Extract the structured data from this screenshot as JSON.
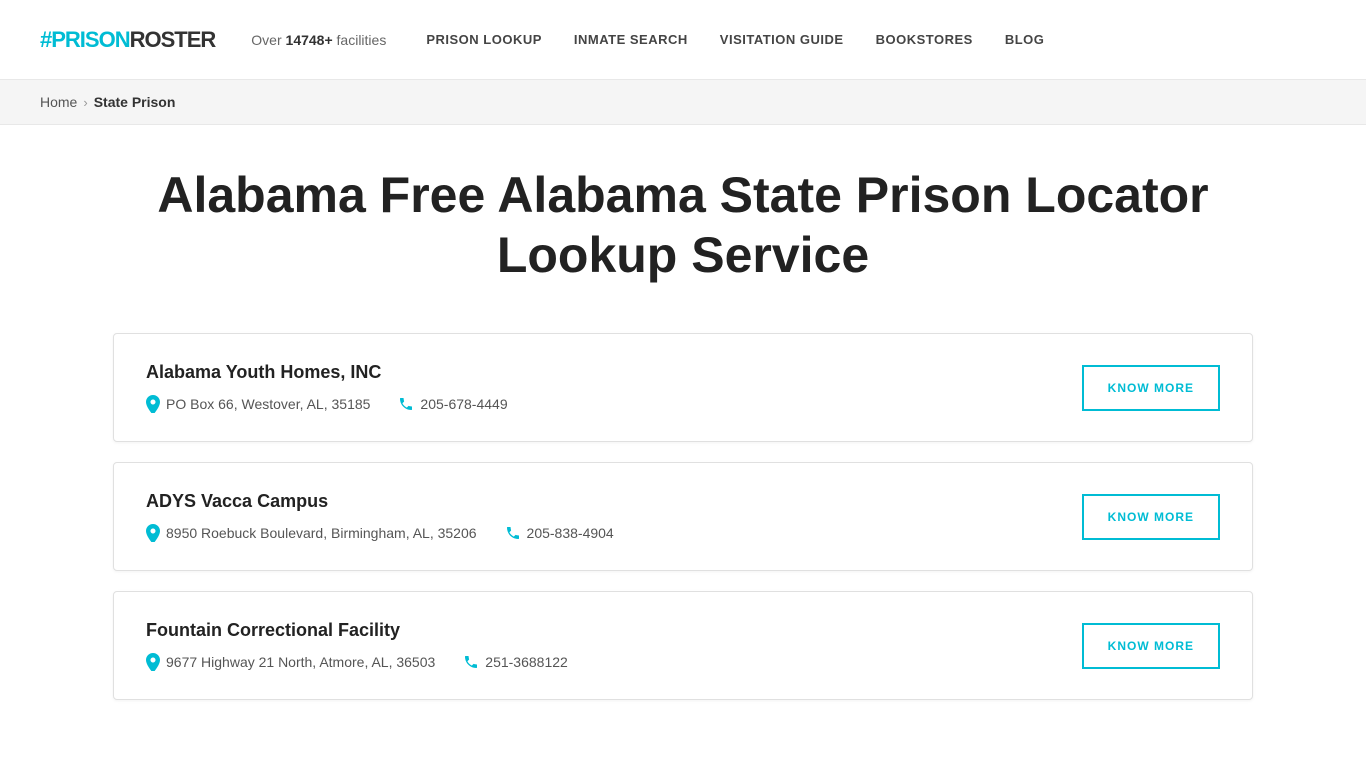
{
  "header": {
    "logo_hash": "#",
    "logo_prison": "PRISON",
    "logo_roster": "ROSTER",
    "facilities_prefix": "Over ",
    "facilities_count": "14748+",
    "facilities_suffix": " facilities",
    "nav": [
      {
        "label": "PRISON LOOKUP",
        "id": "prison-lookup"
      },
      {
        "label": "INMATE SEARCH",
        "id": "inmate-search"
      },
      {
        "label": "VISITATION GUIDE",
        "id": "visitation-guide"
      },
      {
        "label": "BOOKSTORES",
        "id": "bookstores"
      },
      {
        "label": "BLOG",
        "id": "blog"
      }
    ]
  },
  "breadcrumb": {
    "home": "Home",
    "separator": "›",
    "current": "State Prison"
  },
  "main": {
    "page_title": "Alabama Free Alabama State Prison Locator Lookup Service",
    "facilities": [
      {
        "name": "Alabama Youth Homes, INC",
        "address": "PO Box 66, Westover, AL, 35185",
        "phone": "205-678-4449",
        "button_label": "KNOW MORE"
      },
      {
        "name": "ADYS Vacca Campus",
        "address": "8950 Roebuck Boulevard, Birmingham, AL, 35206",
        "phone": "205-838-4904",
        "button_label": "KNOW MORE"
      },
      {
        "name": "Fountain Correctional Facility",
        "address": "9677 Highway 21 North, Atmore, AL, 36503",
        "phone": "251-3688122",
        "button_label": "KNOW MORE"
      }
    ]
  },
  "colors": {
    "accent": "#00bcd4",
    "text_dark": "#222222",
    "text_muted": "#555555"
  }
}
